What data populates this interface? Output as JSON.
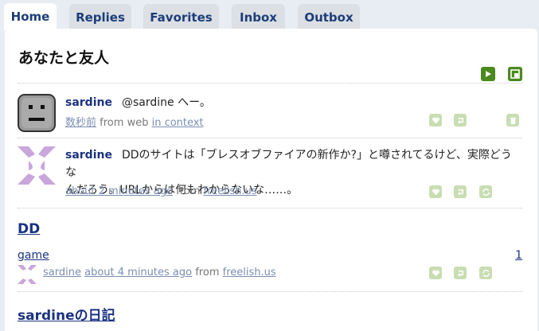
{
  "tabs": [
    {
      "label": "Home",
      "active": true
    },
    {
      "label": "Replies"
    },
    {
      "label": "Favorites"
    },
    {
      "label": "Inbox"
    },
    {
      "label": "Outbox"
    }
  ],
  "page_title": "あなたと友人",
  "notices": [
    {
      "author": "sardine",
      "text": "@sardine へー。",
      "time": "数秒前",
      "from_label": "from",
      "source": "web",
      "context_link": "in context"
    },
    {
      "author": "sardine",
      "text_line1": "DDのサイトは「ブレスオブファイアの新作か?」と噂されてるけど、実際どうな",
      "text_line2": "んだろう。URLからは何もわからないな……。",
      "time": "about 2 minutes ago",
      "from_label": "from",
      "source": "freelish.us"
    }
  ],
  "group": {
    "title": "DD",
    "item_name": "game",
    "item_count": "1",
    "author": "sardine",
    "time": "about 4 minutes ago",
    "from_label": "from",
    "source": "freelish.us"
  },
  "next_group_title": "sardineの日記",
  "colors": {
    "background": "#e8edf3",
    "tab_inactive": "#dcdfe3",
    "link": "#1b3380",
    "accent_green": "#4a8a1e",
    "action_green": "#c9ddb3"
  },
  "icons": {
    "play": "play-icon",
    "expand": "expand-icon",
    "favorite": "heart-icon",
    "reply": "reply-icon",
    "delete": "trash-icon",
    "repeat": "repeat-icon"
  }
}
